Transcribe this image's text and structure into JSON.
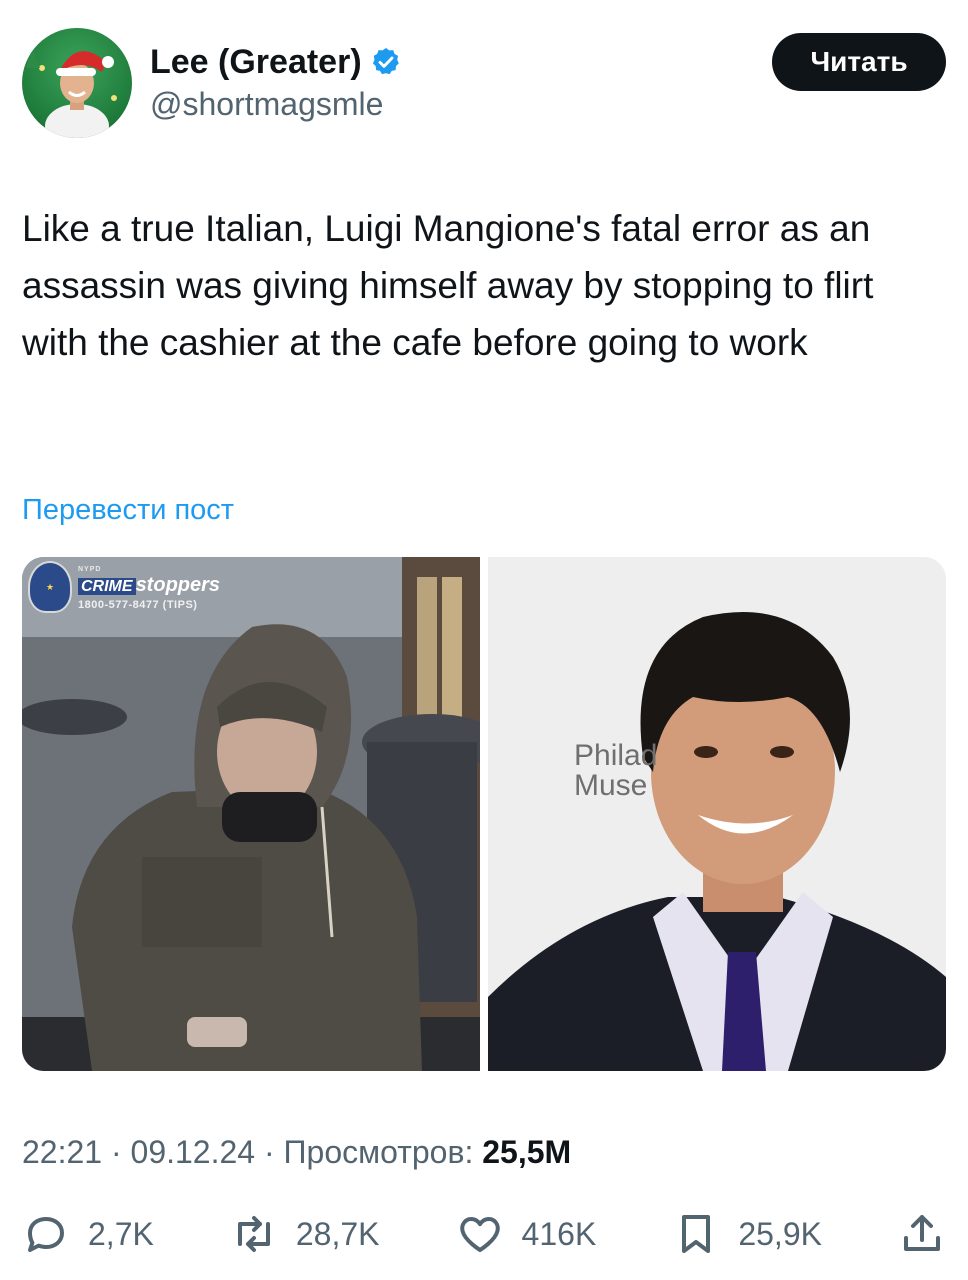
{
  "author": {
    "display_name": "Lee (Greater)",
    "handle": "@shortmagsmle",
    "verified_icon": "verified-badge-icon",
    "follow_label": "Читать"
  },
  "tweet": {
    "text": "Like a true Italian, Luigi Mangione's fatal error as an assassin was giving himself away by stopping to flirt with the cashier at the cafe before going to work",
    "translate_label": "Перевести пост"
  },
  "media": {
    "left": {
      "badge_top": "NYPD",
      "badge_crime": "CRIME",
      "badge_stoppers": "stoppers",
      "badge_phone": "1800-577-8477 (TIPS)"
    },
    "right": {
      "backdrop_line1": "Philad",
      "backdrop_line2": "Muse"
    }
  },
  "meta": {
    "time": "22:21",
    "separator": " · ",
    "date": "09.12.24",
    "views_label": "Просмотров:",
    "views_value": "25,5M"
  },
  "actions": {
    "replies": "2,7K",
    "reposts": "28,7K",
    "likes": "416K",
    "bookmarks": "25,9K"
  },
  "colors": {
    "accent": "#1d9bf0",
    "text": "#0f1419",
    "secondary": "#536471",
    "button_bg": "#0f1419"
  }
}
